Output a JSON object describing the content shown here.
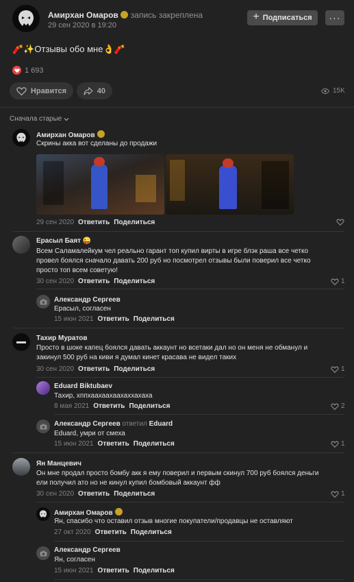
{
  "post": {
    "author": "Амирхан Омаров",
    "pinned": "запись закреплена",
    "date": "29 сен 2020 в 19:20",
    "subscribe": "Подписаться",
    "more": "···",
    "text": "🧨✨Отзывы обо мне👌🧨",
    "reactions_count": "1 693",
    "like_label": "Нравится",
    "share_count": "40",
    "views": "15K"
  },
  "comments_sort": "Сначала старые",
  "comments": [
    {
      "name": "Амирхан Омаров",
      "lines": [
        "Скрины акка вот сделаны до продажи"
      ],
      "date": "29 сен 2020",
      "reply": "Ответить",
      "share": "Поделиться",
      "likes": ""
    },
    {
      "name": "Ерасыл Баят 😜",
      "lines": [
        "Всем Саламалейкум чел реально гарант топ купил вирты в игре блэк раша все четко",
        "провел боялся сначало давать 200 руб но посмотрел отзывы были поверил все четко",
        "просто топ всем советую!"
      ],
      "date": "30 сен 2020",
      "reply": "Ответить",
      "share": "Поделиться",
      "likes": "1"
    },
    {
      "name": "Александр Сергеев",
      "lines": [
        "Ерасыл, согласен"
      ],
      "date": "15 июн 2021",
      "reply": "Ответить",
      "share": "Поделиться",
      "likes": ""
    },
    {
      "name": "Тахир Муратов",
      "lines": [
        "Просто в шоке капец боялся давать аккаунт но всетаки дал но он меня не обманул и",
        "закинул 500 руб на киви я думал кинет красава не видел таких"
      ],
      "date": "30 сен 2020",
      "reply": "Ответить",
      "share": "Поделиться",
      "likes": "1"
    },
    {
      "name": "Eduard Biktubaev",
      "lines": [
        "Тахир, хппхаахаахаахаххахаха"
      ],
      "date": "8 мая 2021",
      "reply": "Ответить",
      "share": "Поделиться",
      "likes": "2"
    },
    {
      "name": "Александр Сергеев",
      "replied": "ответил",
      "replied_to": "Eduard",
      "lines": [
        "Eduard, умри от смеха"
      ],
      "date": "15 июн 2021",
      "reply": "Ответить",
      "share": "Поделиться",
      "likes": "1"
    },
    {
      "name": "Ян Манцевич",
      "lines": [
        "Он мне продал просто бомбу акк я ему поверил и первым скинул 700 руб боялся деньги",
        "ели получил ато но не кинул купил бомбовый аккаунт фф"
      ],
      "date": "30 сен 2020",
      "reply": "Ответить",
      "share": "Поделиться",
      "likes": "1"
    },
    {
      "name": "Амирхан Омаров",
      "lines": [
        "Ян, спасибо что оставил отзыв многие покупатели/продавцы не оставляют"
      ],
      "date": "27 окт 2020",
      "reply": "Ответить",
      "share": "Поделиться",
      "likes": ""
    },
    {
      "name": "Александр Сергеев",
      "lines": [
        "Ян, согласен"
      ],
      "date": "15 июн 2021",
      "reply": "Ответить",
      "share": "Поделиться",
      "likes": ""
    }
  ],
  "colors": {
    "background": "#222222",
    "text": "#e1e3e6",
    "muted": "#939393",
    "button": "#4a4a4a",
    "heart": "#e64646",
    "verified": "#c9a227"
  },
  "icons": [
    "bape-logo-icon",
    "verified-badge-icon",
    "plus-icon",
    "heart-icon",
    "share-arrow-icon",
    "eye-icon",
    "chevron-down-icon",
    "camera-icon"
  ]
}
